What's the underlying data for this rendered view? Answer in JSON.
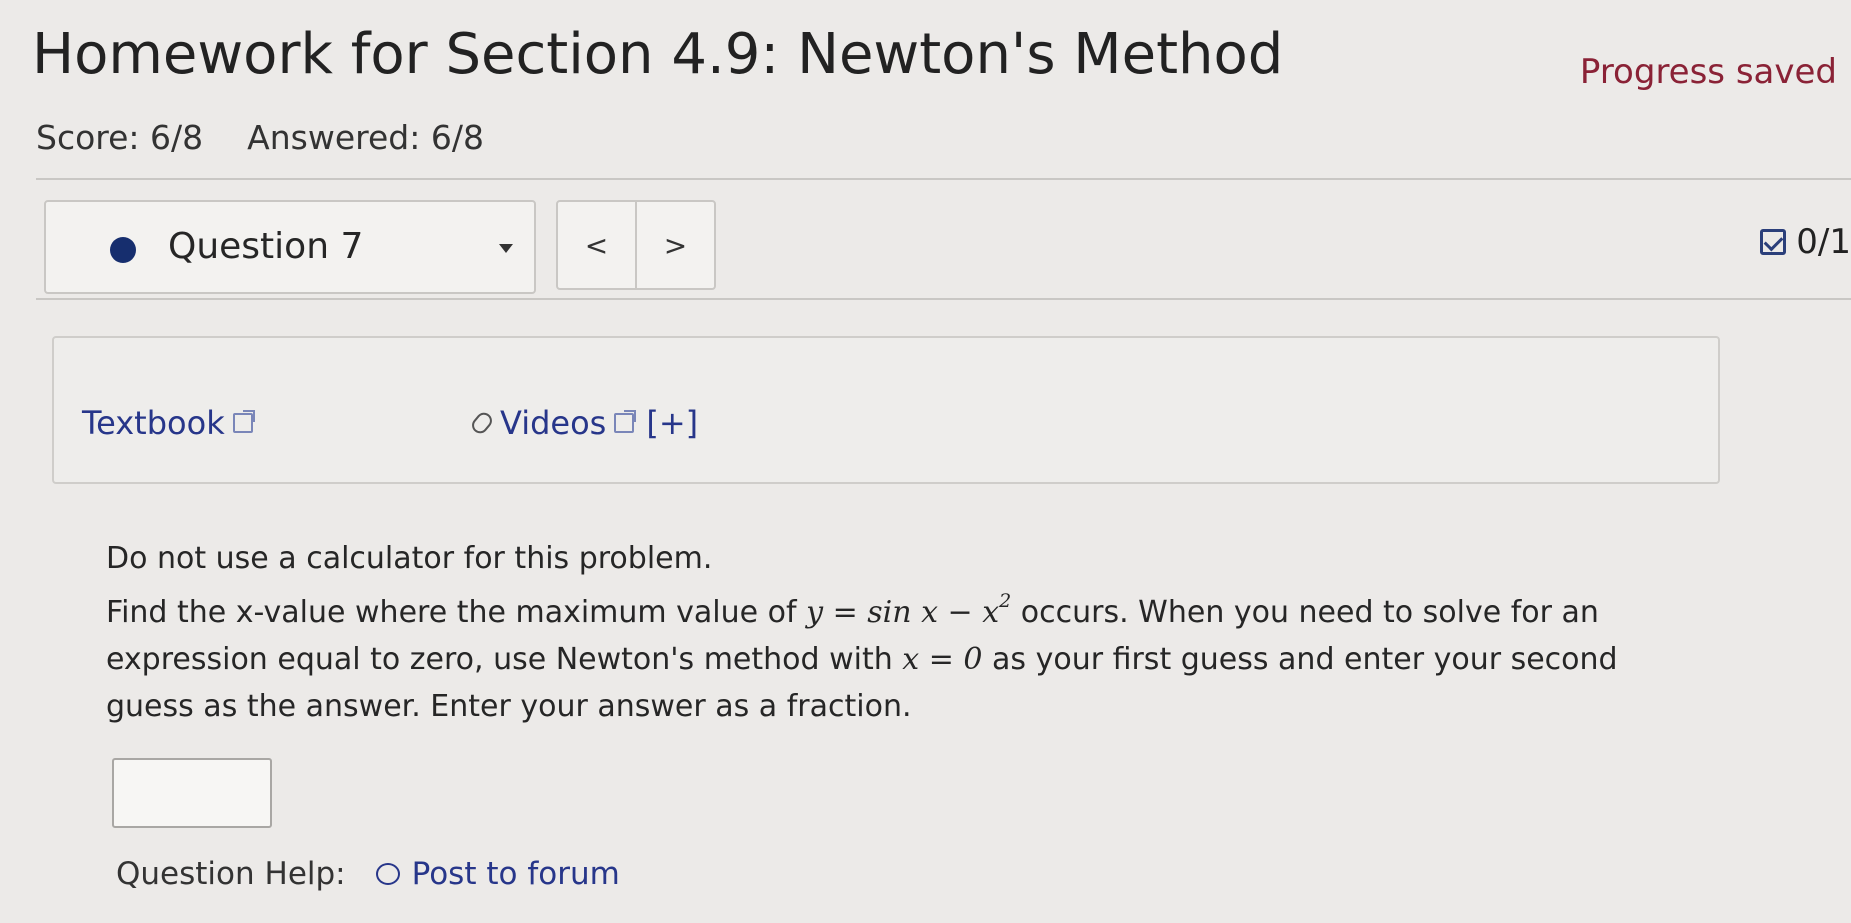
{
  "header": {
    "title": "Homework for Section 4.9: Newton's Method",
    "progress_status": "Progress saved",
    "score": "Score: 6/8",
    "answered": "Answered: 6/8"
  },
  "question_nav": {
    "selected": "Question 7",
    "prev_label": "<",
    "next_label": ">",
    "points": "0/1"
  },
  "resources": {
    "textbook": "Textbook",
    "videos": "Videos",
    "expand": "[+]"
  },
  "problem": {
    "line1": "Do not use a calculator for this problem.",
    "p2_pre": "Find the x-value where the maximum value of ",
    "p2_math": "y = sin x − x",
    "p2_exp": "2",
    "p2_mid": " occurs. When you need to solve for an expression equal to zero, use Newton's method with ",
    "p2_math2": "x = 0",
    "p2_post": " as your first guess and enter your second guess as the answer. Enter your answer as a fraction."
  },
  "answer": {
    "value": ""
  },
  "help": {
    "label": "Question Help:",
    "forum": "Post to forum"
  },
  "colors": {
    "background": "#eceae8",
    "link": "#27368a",
    "progress": "#8a2236",
    "selected_dot": "#162e6e"
  }
}
